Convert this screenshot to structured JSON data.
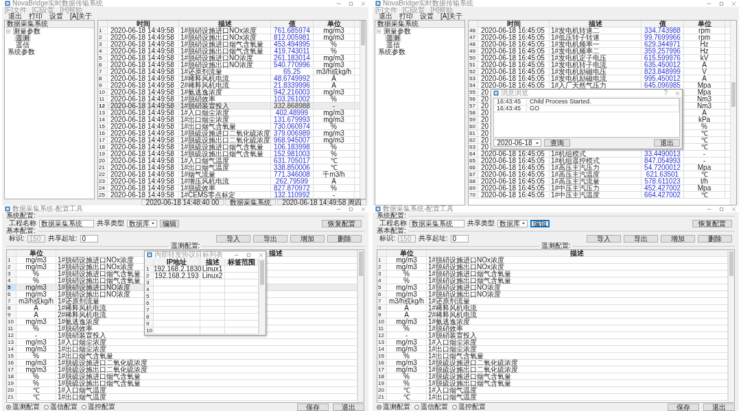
{
  "monitor_windows": [
    {
      "title": "NovaBridge实时数据传输系统",
      "menu": [
        "[F]文件",
        "[C]设置",
        "[H]帮助"
      ],
      "toolbar": [
        "退出",
        "打印",
        "设置",
        "[A]关于"
      ],
      "tree": {
        "header": "数据采集系统",
        "items": [
          {
            "label": "测量参数",
            "expanded": true,
            "selected": false,
            "children": [
              {
                "label": "遥测",
                "selected": true
              },
              {
                "label": "遥信",
                "selected": false
              }
            ]
          },
          {
            "label": "系统参数",
            "selected": false
          }
        ]
      },
      "table": {
        "columns": [
          "时间",
          "描述",
          "值",
          "单位"
        ],
        "rows": [
          {
            "num": "1",
            "time": "2020-06-18 14:49:58",
            "desc": "1#脱硝设施进口NOx浓度",
            "value": "761.685974",
            "unit": "mg/m3",
            "selected": false
          },
          {
            "num": "2",
            "time": "2020-06-18 14:49:58",
            "desc": "1#脱硝设施出口NOx浓度",
            "value": "812.005981",
            "unit": "mg/m3",
            "selected": false
          },
          {
            "num": "3",
            "time": "2020-06-18 14:49:58",
            "desc": "1#脱硝设施进口烟气含氧量",
            "value": "453.494995",
            "unit": "%",
            "selected": false
          },
          {
            "num": "4",
            "time": "2020-06-18 14:49:58",
            "desc": "1#脱硝设施出口烟气含氧量",
            "value": "419.743011",
            "unit": "%",
            "selected": false
          },
          {
            "num": "5",
            "time": "2020-06-18 14:49:58",
            "desc": "1#脱硝设施进口NO浓度",
            "value": "261.183014",
            "unit": "mg/m3",
            "selected": false
          },
          {
            "num": "6",
            "time": "2020-06-18 14:49:58",
            "desc": "1#脱硝设施出口NO浓度",
            "value": "540.770996",
            "unit": "mg/m3",
            "selected": false
          },
          {
            "num": "7",
            "time": "2020-06-18 14:49:58",
            "desc": "1#还原剂流量",
            "value": "65.25",
            "unit": "m3/h或kg/h",
            "selected": false
          },
          {
            "num": "8",
            "time": "2020-06-18 14:49:58",
            "desc": "1#稀释风机电流",
            "value": "48.6749992",
            "unit": "A",
            "selected": false
          },
          {
            "num": "9",
            "time": "2020-06-18 14:49:58",
            "desc": "2#稀释风机电流",
            "value": "21.8339996",
            "unit": "A",
            "selected": false
          },
          {
            "num": "10",
            "time": "2020-06-18 14:49:58",
            "desc": "1#氨逃逸浓度",
            "value": "942.216003",
            "unit": "mg/m3",
            "selected": false
          },
          {
            "num": "11",
            "time": "2020-06-18 14:49:58",
            "desc": "1#脱硝效率",
            "value": "103.261002",
            "unit": "%",
            "selected": false
          },
          {
            "num": "12",
            "time": "2020-06-18 14:49:58",
            "desc": "1#脱硝装置投入",
            "value": "332.868988",
            "unit": "-",
            "selected": true
          },
          {
            "num": "13",
            "time": "2020-06-18 14:49:58",
            "desc": "1#入口烟尘浓度",
            "value": "402.48999",
            "unit": "mg/m3",
            "selected": false
          },
          {
            "num": "14",
            "time": "2020-06-18 14:49:58",
            "desc": "1#出口烟尘浓度",
            "value": "131.679993",
            "unit": "mg/m3",
            "selected": false
          },
          {
            "num": "15",
            "time": "2020-06-18 14:49:58",
            "desc": "1#出口烟气含氧量",
            "value": "730.060974",
            "unit": "%",
            "selected": false
          },
          {
            "num": "16",
            "time": "2020-06-18 14:49:58",
            "desc": "1#脱硫设施进口二氧化硫浓度",
            "value": "379.006989",
            "unit": "mg/m3",
            "selected": false
          },
          {
            "num": "17",
            "time": "2020-06-18 14:49:58",
            "desc": "1#脱硫设施出口二氧化硫浓度",
            "value": "968.945007",
            "unit": "mg/m3",
            "selected": false
          },
          {
            "num": "18",
            "time": "2020-06-18 14:49:58",
            "desc": "1#脱硫设施进口烟气含氧量",
            "value": "106.183998",
            "unit": "%",
            "selected": false
          },
          {
            "num": "19",
            "time": "2020-06-18 14:49:58",
            "desc": "1#脱硫设施出口烟气含氧量",
            "value": "152.981003",
            "unit": "%",
            "selected": false
          },
          {
            "num": "20",
            "time": "2020-06-18 14:49:58",
            "desc": "1#入口烟气温度",
            "value": "631.705017",
            "unit": "℃",
            "selected": false
          },
          {
            "num": "21",
            "time": "2020-06-18 14:49:58",
            "desc": "1#出口烟气温度",
            "value": "338.850006",
            "unit": "℃",
            "selected": false
          },
          {
            "num": "22",
            "time": "2020-06-18 14:49:58",
            "desc": "1#烟气流量",
            "value": "771.346008",
            "unit": "千m3/h",
            "selected": false
          },
          {
            "num": "23",
            "time": "2020-06-18 14:49:58",
            "desc": "1#增压风机电流",
            "value": "262.79599",
            "unit": "A",
            "selected": false
          },
          {
            "num": "24",
            "time": "2020-06-18 14:49:58",
            "desc": "1#脱硫效率",
            "value": "827.870972",
            "unit": "%",
            "selected": false
          },
          {
            "num": "25",
            "time": "2020-06-18 14:49:58",
            "desc": "1#CEMS零点标定",
            "value": "132.110992",
            "unit": "-",
            "selected": false
          }
        ]
      },
      "status_bar": [
        "2020-06-18 14:48:40 00",
        "数据采集系统",
        "2020-06-18 14:49:58 周四"
      ]
    },
    {
      "title": "NovaBridge实时数据传输系统",
      "menu": [
        "[F]文件",
        "[C]设置",
        "[H]帮助"
      ],
      "toolbar": [
        "退出",
        "打印",
        "设置",
        "[A]关于"
      ],
      "tree": {
        "header": "数据采集系统",
        "items": [
          {
            "label": "测量参数",
            "expanded": true,
            "selected": false,
            "children": [
              {
                "label": "遥测",
                "selected": true
              },
              {
                "label": "遥信",
                "selected": false
              }
            ]
          },
          {
            "label": "系统参数",
            "selected": false
          }
        ]
      },
      "table": {
        "columns": [
          "时间",
          "描述",
          "值",
          "单位"
        ],
        "rows": [
          {
            "num": "46",
            "time": "2020-06-18 16:45:05",
            "desc": "1#发电机转速二",
            "value": "334.743988",
            "unit": "rpm",
            "selected": false
          },
          {
            "num": "47",
            "time": "2020-06-18 16:45:05",
            "desc": "1#低压转子转速",
            "value": "99.7699966",
            "unit": "rpm",
            "selected": false
          },
          {
            "num": "48",
            "time": "2020-06-18 16:45:05",
            "desc": "1#发电机频率一",
            "value": "629.344971",
            "unit": "Hz",
            "selected": false
          },
          {
            "num": "49",
            "time": "2020-06-18 16:45:05",
            "desc": "1#发电机频率二",
            "value": "359.257996",
            "unit": "Hz",
            "selected": false
          },
          {
            "num": "50",
            "time": "2020-06-18 16:45:05",
            "desc": "1#发电机定子电压",
            "value": "615.599976",
            "unit": "kV",
            "selected": false
          },
          {
            "num": "51",
            "time": "2020-06-18 16:45:05",
            "desc": "1#发电机转子电流",
            "value": "635.450012",
            "unit": "A",
            "selected": false
          },
          {
            "num": "52",
            "time": "2020-06-18 16:45:05",
            "desc": "1#发电机励磁电压",
            "value": "823.848999",
            "unit": "V",
            "selected": false
          },
          {
            "num": "53",
            "time": "2020-06-18 16:45:05",
            "desc": "1#发电机励磁电流",
            "value": "995.450012",
            "unit": "A",
            "selected": false
          },
          {
            "num": "54",
            "time": "2020-06-18 16:45:05",
            "desc": "1#入厂天然气压力",
            "value": "645.096985",
            "unit": "Mpa",
            "selected": false
          },
          {
            "num": "55",
            "time": "20",
            "unit": "Mpa",
            "selected": false
          },
          {
            "num": "56",
            "time": "20",
            "unit": "Nm3",
            "selected": false
          },
          {
            "num": "57",
            "time": "20",
            "unit": "Nm3",
            "selected": false
          },
          {
            "num": "58",
            "time": "20",
            "unit": "A",
            "selected": false
          },
          {
            "num": "59",
            "time": "20",
            "unit": "kPa",
            "selected": false
          },
          {
            "num": "60",
            "time": "20",
            "unit": "%",
            "selected": false
          },
          {
            "num": "61",
            "time": "20",
            "unit": "℃",
            "selected": false
          },
          {
            "num": "62",
            "time": "20",
            "unit": "℃",
            "selected": false
          },
          {
            "num": "63",
            "time": "20",
            "unit": "℃",
            "selected": false
          },
          {
            "num": "64",
            "time": "2020-06-18 16:45:05",
            "desc": "1#机组模式",
            "value": "33.4490013",
            "unit": "-",
            "selected": false
          },
          {
            "num": "65",
            "time": "2020-06-18 16:45:05",
            "desc": "1#机组遥控模式",
            "value": "847.054993",
            "unit": "-",
            "selected": false
          },
          {
            "num": "66",
            "time": "2020-06-18 16:45:05",
            "desc": "1#高压主汽压力",
            "value": "54.7200012",
            "unit": "Mpa",
            "selected": false
          },
          {
            "num": "67",
            "time": "2020-06-18 16:45:05",
            "desc": "1#高压主汽温度",
            "value": "621.63501",
            "unit": "℃",
            "selected": false
          },
          {
            "num": "68",
            "time": "2020-06-18 16:45:05",
            "desc": "1#高压主汽流量",
            "value": "578.611023",
            "unit": "t/h",
            "selected": false
          },
          {
            "num": "69",
            "time": "2020-06-18 16:45:05",
            "desc": "1#中压主汽压力",
            "value": "452.427002",
            "unit": "Mpa",
            "selected": false
          },
          {
            "num": "70",
            "time": "2020-06-18 16:45:05",
            "desc": "1#中压主汽温度",
            "value": "664.427002",
            "unit": "℃",
            "selected": false
          }
        ]
      },
      "dialog": {
        "title": "消息浏览",
        "help": "?",
        "log": [
          {
            "time": "16:43:45",
            "message": "Child Process Started."
          },
          {
            "time": "16:43:45",
            "message": "GO"
          }
        ],
        "date": "2020-06-18",
        "query_button": "查询",
        "exit_button": "退出"
      }
    }
  ],
  "config_windows": [
    {
      "title": "数据采集系统-配置工具",
      "system_config": {
        "label": "系统配置:",
        "name_label": "工程名称",
        "name": "数据采集系统",
        "type_label": "共享类型",
        "type": "数据库",
        "edit_button": "编辑",
        "edit_focused": false,
        "restore_button": "恢复配置"
      },
      "basic_config": {
        "label": "基本配置:",
        "id_label": "标识:",
        "id": "150",
        "id_disabled": true,
        "addr_label": "共享起址:",
        "addr": "0",
        "buttons": [
          "导入",
          "导出",
          "增加",
          "删除"
        ]
      },
      "section_label": "遥测配置:",
      "table": {
        "columns": [
          "单位",
          "描述"
        ],
        "rows": [
          {
            "num": "1",
            "unit": "mg/m3",
            "desc": "1#脱硝设施进口NOx浓度",
            "selected": false
          },
          {
            "num": "2",
            "unit": "mg/m3",
            "desc": "1#脱硝设施出口NOx浓度",
            "selected": false
          },
          {
            "num": "3",
            "unit": "%",
            "desc": "1#脱硝设施进口烟气含氧量",
            "selected": false
          },
          {
            "num": "4",
            "unit": "%",
            "desc": "1#脱硝设施出口烟气含氧量",
            "selected": false
          },
          {
            "num": "5",
            "unit": "mg/m3",
            "desc": "1#脱硝设施进口NO浓度",
            "selected": true
          },
          {
            "num": "6",
            "unit": "mg/m3",
            "desc": "1#脱硝设施出口NO浓度",
            "selected": false
          },
          {
            "num": "7",
            "unit": "m3/h或kg/h",
            "desc": "1#还原剂流量",
            "selected": false
          },
          {
            "num": "8",
            "unit": "A",
            "desc": "1#稀释风机电流",
            "selected": false
          },
          {
            "num": "9",
            "unit": "A",
            "desc": "2#稀释风机电流",
            "selected": false
          },
          {
            "num": "10",
            "unit": "mg/m3",
            "desc": "1#氨逃逸浓度",
            "selected": false
          },
          {
            "num": "11",
            "unit": "%",
            "desc": "1#脱硝效率",
            "selected": false
          },
          {
            "num": "12",
            "unit": "-",
            "desc": "1#脱硝装置投入",
            "selected": false
          },
          {
            "num": "13",
            "unit": "mg/m3",
            "desc": "1#入口烟尘浓度",
            "selected": false
          },
          {
            "num": "14",
            "unit": "mg/m3",
            "desc": "1#出口烟尘浓度",
            "selected": false
          },
          {
            "num": "15",
            "unit": "%",
            "desc": "1#出口烟气含氧量",
            "selected": false
          },
          {
            "num": "16",
            "unit": "mg/m3",
            "desc": "1#脱硫设施进口二氧化硫浓度",
            "selected": false
          },
          {
            "num": "17",
            "unit": "mg/m3",
            "desc": "1#脱硫设施出口二氧化硫浓度",
            "selected": false
          },
          {
            "num": "18",
            "unit": "%",
            "desc": "1#脱硫设施进口烟气含氧量",
            "selected": false
          },
          {
            "num": "19",
            "unit": "%",
            "desc": "1#脱硫设施出口烟气含氧量",
            "selected": false
          },
          {
            "num": "20",
            "unit": "℃",
            "desc": "1#入口烟气温度",
            "selected": false
          },
          {
            "num": "21",
            "unit": "℃",
            "desc": "1#出口烟气温度",
            "selected": false
          }
        ]
      },
      "radios": [
        {
          "label": "遥测配置",
          "selected": true
        },
        {
          "label": "遥信配置",
          "selected": false
        },
        {
          "label": "遥控配置",
          "selected": false
        }
      ],
      "buttons": [
        "保存",
        "退出"
      ],
      "dialog": {
        "title": "内部转发协议目标列表",
        "columns": [
          "IP地址",
          "描述",
          "标签范围"
        ],
        "rows": [
          {
            "num": "1",
            "ip": "192.168.2.1830",
            "desc": "Linux1"
          },
          {
            "num": "2",
            "ip": "192.168.2.193",
            "desc": "Linux2"
          },
          {
            "num": "3"
          },
          {
            "num": "4"
          },
          {
            "num": "5"
          },
          {
            "num": "6"
          },
          {
            "num": "7"
          },
          {
            "num": "8"
          },
          {
            "num": "9"
          },
          {
            "num": "10"
          }
        ]
      }
    },
    {
      "title": "数据采集系统-配置工具",
      "system_config": {
        "label": "系统配置:",
        "name_label": "工程名称",
        "name": "数据采集系统",
        "type_label": "共享类型",
        "type": "数据库",
        "edit_button": "编辑",
        "edit_focused": true,
        "restore_button": "恢复配置"
      },
      "basic_config": {
        "label": "基本配置:",
        "id_label": "标识:",
        "id": "150",
        "id_disabled": true,
        "addr_label": "共享起址:",
        "addr": "0",
        "buttons": [
          "导入",
          "导出",
          "增加",
          "删除"
        ]
      },
      "section_label": "遥测配置:",
      "table": {
        "columns": [
          "单位",
          "描述"
        ],
        "rows": [
          {
            "num": "1",
            "unit": "mg/m3",
            "desc": "1#脱硝设施进口NOx浓度",
            "selected": false
          },
          {
            "num": "2",
            "unit": "mg/m3",
            "desc": "1#脱硝设施出口NOx浓度",
            "selected": false
          },
          {
            "num": "3",
            "unit": "%",
            "desc": "1#脱硝设施进口烟气含氧量",
            "selected": false
          },
          {
            "num": "4",
            "unit": "%",
            "desc": "1#脱硝设施出口烟气含氧量",
            "selected": false
          },
          {
            "num": "5",
            "unit": "mg/m3",
            "desc": "1#脱硝设施进口NO浓度",
            "selected": false
          },
          {
            "num": "6",
            "unit": "mg/m3",
            "desc": "1#脱硝设施出口NO浓度",
            "selected": false
          },
          {
            "num": "7",
            "unit": "m3/h或kg/h",
            "desc": "1#还原剂流量",
            "selected": false
          },
          {
            "num": "8",
            "unit": "A",
            "desc": "1#稀释风机电流",
            "selected": false
          },
          {
            "num": "9",
            "unit": "A",
            "desc": "2#稀释风机电流",
            "selected": false
          },
          {
            "num": "10",
            "unit": "mg/m3",
            "desc": "1#氨逃逸浓度",
            "selected": false
          },
          {
            "num": "11",
            "unit": "%",
            "desc": "1#脱硝效率",
            "selected": false
          },
          {
            "num": "12",
            "unit": "-",
            "desc": "1#脱硝装置投入",
            "selected": false
          },
          {
            "num": "13",
            "unit": "mg/m3",
            "desc": "1#入口烟尘浓度",
            "selected": false
          },
          {
            "num": "14",
            "unit": "mg/m3",
            "desc": "1#出口烟尘浓度",
            "selected": false
          },
          {
            "num": "15",
            "unit": "%",
            "desc": "1#出口烟气含氧量",
            "selected": false
          },
          {
            "num": "16",
            "unit": "mg/m3",
            "desc": "1#脱硫设施进口二氧化硫浓度",
            "selected": false
          },
          {
            "num": "17",
            "unit": "mg/m3",
            "desc": "1#脱硫设施出口二氧化硫浓度",
            "selected": false
          },
          {
            "num": "18",
            "unit": "%",
            "desc": "1#脱硫设施进口烟气含氧量",
            "selected": false
          },
          {
            "num": "19",
            "unit": "%",
            "desc": "1#脱硫设施出口烟气含氧量",
            "selected": false
          },
          {
            "num": "20",
            "unit": "℃",
            "desc": "1#入口烟气温度",
            "selected": false
          },
          {
            "num": "21",
            "unit": "℃",
            "desc": "1#出口烟气温度",
            "selected": false
          }
        ]
      },
      "radios": [
        {
          "label": "遥测配置",
          "selected": true
        },
        {
          "label": "遥信配置",
          "selected": false
        },
        {
          "label": "遥控配置",
          "selected": false
        }
      ],
      "buttons": [
        "保存",
        "退出"
      ]
    }
  ]
}
